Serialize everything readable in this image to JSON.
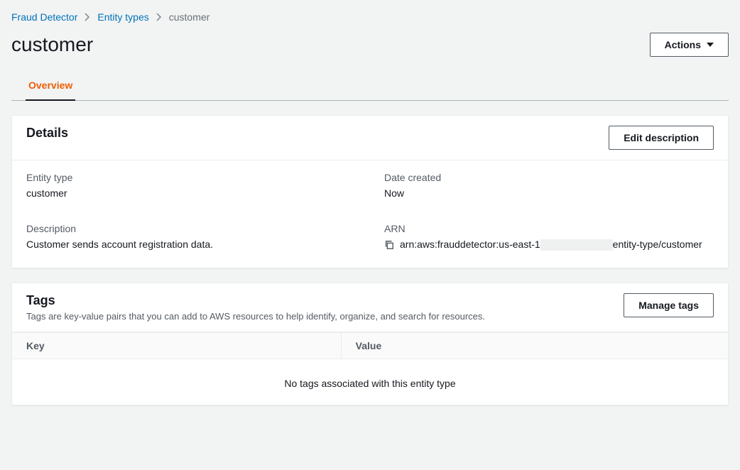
{
  "breadcrumb": {
    "root": "Fraud Detector",
    "mid": "Entity types",
    "current": "customer"
  },
  "header": {
    "title": "customer",
    "actions_label": "Actions"
  },
  "tabs": {
    "overview": "Overview"
  },
  "details": {
    "panel_title": "Details",
    "edit_button": "Edit description",
    "entity_type_label": "Entity type",
    "entity_type_value": "customer",
    "date_created_label": "Date created",
    "date_created_value": "Now",
    "description_label": "Description",
    "description_value": "Customer sends account registration data.",
    "arn_label": "ARN",
    "arn_prefix": "arn:aws:frauddetector:us-east-1",
    "arn_suffix": "entity-type/customer"
  },
  "tags": {
    "panel_title": "Tags",
    "subtitle": "Tags are key-value pairs that you can add to AWS resources to help identify, organize, and search for resources.",
    "manage_button": "Manage tags",
    "key_header": "Key",
    "value_header": "Value",
    "empty": "No tags associated with this entity type"
  }
}
